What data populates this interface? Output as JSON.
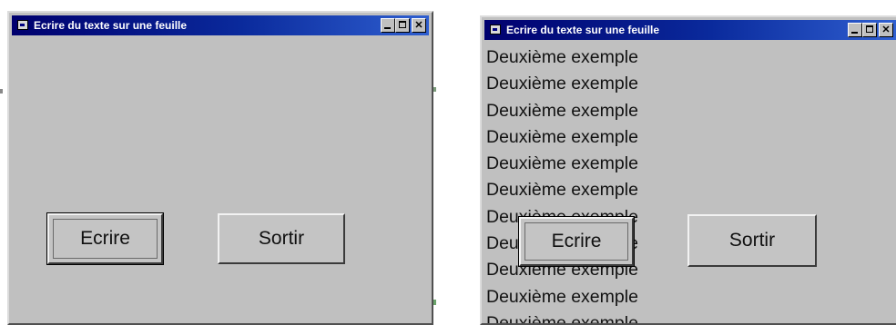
{
  "window1": {
    "title": "Ecrire du texte sur une feuille",
    "buttons": {
      "ecrire": "Ecrire",
      "sortir": "Sortir"
    }
  },
  "window2": {
    "title": "Ecrire du texte sur une feuille",
    "lines": [
      "Deuxième exemple",
      "Deuxième exemple",
      "Deuxième exemple",
      "Deuxième exemple",
      "Deuxième exemple",
      "Deuxième exemple",
      "Deuxième exemple",
      "Deuxième exemple",
      "Deuxième exemple",
      "Deuxième exemple",
      "Deuxième exemple"
    ],
    "buttons": {
      "ecrire": "Ecrire",
      "sortir": "Sortir"
    }
  },
  "icons": {
    "system_menu": "app-window-icon",
    "minimize": "minimize-icon",
    "maximize": "maximize-icon",
    "close": "close-icon"
  },
  "colors": {
    "window_face": "#c0c0c0",
    "titlebar_start": "#00006e",
    "titlebar_end": "#2f5fd0",
    "title_text": "#ffffff"
  }
}
